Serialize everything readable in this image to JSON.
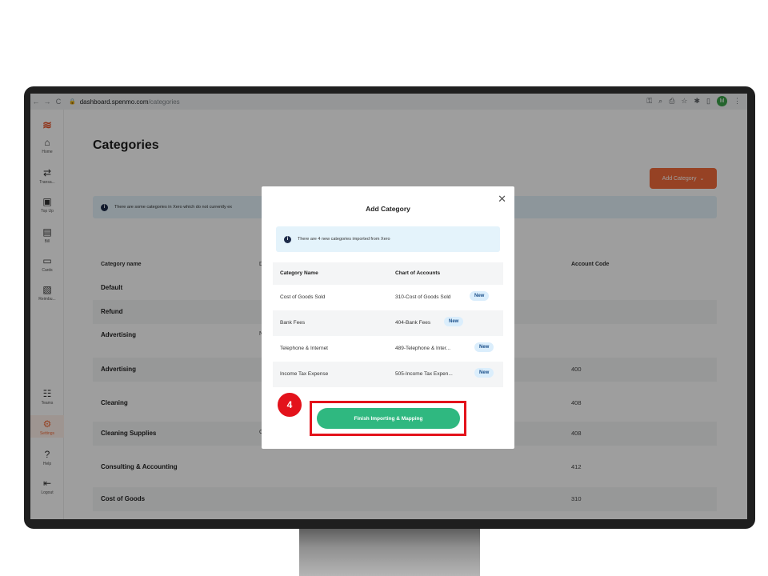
{
  "browser": {
    "back": "←",
    "forward": "→",
    "reload": "C",
    "url_host": "dashboard.spenmo.com",
    "url_path": "/categories",
    "profile_initial": "M"
  },
  "sidebar": {
    "items": [
      {
        "label": "Home",
        "icon": "home-icon",
        "glyph": "⌂"
      },
      {
        "label": "Transa...",
        "icon": "transactions-icon",
        "glyph": "⇄"
      },
      {
        "label": "Top Up",
        "icon": "topup-icon",
        "glyph": "▣"
      },
      {
        "label": "Bill",
        "icon": "bill-icon",
        "glyph": "▤"
      },
      {
        "label": "Cards",
        "icon": "cards-icon",
        "glyph": "▭"
      },
      {
        "label": "Reimbu...",
        "icon": "reimburse-icon",
        "glyph": "▧"
      },
      {
        "label": "Teams",
        "icon": "teams-icon",
        "glyph": "☷"
      },
      {
        "label": "Settings",
        "icon": "settings-icon",
        "glyph": "⚙"
      },
      {
        "label": "Help",
        "icon": "help-icon",
        "glyph": "?"
      },
      {
        "label": "Logout",
        "icon": "logout-icon",
        "glyph": "⇤"
      }
    ]
  },
  "page": {
    "title": "Categories",
    "add_button": "Add Category",
    "banner": "There are some categories in Xero which do not currently ex",
    "columns": {
      "name": "Category name",
      "partial": "D",
      "code": "Account Code"
    },
    "rows": [
      {
        "name": "Default",
        "partial": "",
        "code": ""
      },
      {
        "name": "Refund",
        "partial": "",
        "code": ""
      },
      {
        "name": "Advertising",
        "partial": "N",
        "code": ""
      },
      {
        "name": "Advertising",
        "partial": "",
        "code": "400"
      },
      {
        "name": "Cleaning",
        "partial": "",
        "code": "408"
      },
      {
        "name": "Cleaning Supplies",
        "partial": "C",
        "code": "408"
      },
      {
        "name": "Consulting & Accounting",
        "partial": "",
        "code": "412"
      },
      {
        "name": "Cost of Goods",
        "partial": "",
        "code": "310"
      }
    ]
  },
  "modal": {
    "title": "Add Category",
    "info": "There are 4 new categories imported from Xero",
    "headers": {
      "name": "Category Name",
      "account": "Chart of Accounts"
    },
    "rows": [
      {
        "name": "Cost of Goods Sold",
        "account": "310-Cost of Goods Sold",
        "badge": "New"
      },
      {
        "name": "Bank Fees",
        "account": "404-Bank Fees",
        "badge": "New"
      },
      {
        "name": "Telephone & Internet",
        "account": "489-Telephone & Inter...",
        "badge": "New"
      },
      {
        "name": "Income Tax Expense",
        "account": "505-Income Tax Expen...",
        "badge": "New"
      }
    ],
    "finish_button": "Finish Importing & Mapping"
  },
  "annotation": {
    "step": "4"
  },
  "colors": {
    "brand": "#f26b3a",
    "primary_green": "#2fb880",
    "highlight_red": "#e3121b"
  }
}
